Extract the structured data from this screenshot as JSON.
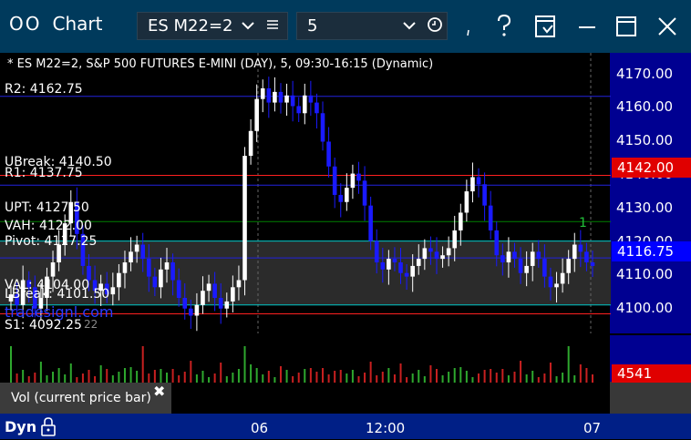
{
  "window": {
    "title": "Chart",
    "glyph": "OO",
    "symbol_select": "ES M22=2",
    "interval_select": "5"
  },
  "chart_header": "* ES M22=2, S&P 500 FUTURES E-MINI (DAY), 5, 09:30-16:15 (Dynamic)",
  "price_axis": {
    "ticks": [
      "4170.00",
      "4160.00",
      "4150.00",
      "4140.00",
      "4130.00",
      "4120.00",
      "4110.00",
      "4100.00"
    ],
    "badges": [
      {
        "label": "4142.00",
        "color": "#e00000"
      },
      {
        "label": "4116.75",
        "color": "#0000ff"
      }
    ]
  },
  "levels": {
    "r2": "R2: 4162.75",
    "ubreak": "UBreak: 4140.50",
    "r1": "R1: 4137.75",
    "upt": "UPT: 4127.50",
    "vah": "VAH: 4122.00",
    "pivot": "Pivot: 4117.25",
    "val": "VAL: 4104.00",
    "lbreak": "LBreak: 4101.50",
    "s1": "S1: 4092.25",
    "watermark": "tradesignl.com",
    "partial": "22",
    "marker": "1"
  },
  "volume": {
    "label": "Vol (current price bar)",
    "badge": "4541",
    "badge_color": "#e00000"
  },
  "time_axis": {
    "ticks": [
      "06",
      "12:00",
      "07"
    ]
  },
  "bottom_bar": {
    "label": "Dyn",
    "lock_icon": "lock-icon"
  },
  "chart_data": {
    "type": "candlestick",
    "ylim": [
      4096,
      4175
    ],
    "overlay_levels": [
      {
        "name": "R2",
        "value": 4162.75,
        "color": "#2222dd"
      },
      {
        "name": "UBreak",
        "value": 4140.5,
        "color": "#ff2020"
      },
      {
        "name": "R1",
        "value": 4137.75,
        "color": "#2222dd"
      },
      {
        "name": "UPT",
        "value": 4127.5,
        "color": "#008000"
      },
      {
        "name": "VAH",
        "value": 4122.0,
        "color": "#00c8c8"
      },
      {
        "name": "Pivot",
        "value": 4117.25,
        "color": "#2222dd"
      },
      {
        "name": "VAL",
        "value": 4104.0,
        "color": "#00c8c8"
      },
      {
        "name": "LBreak",
        "value": 4101.5,
        "color": "#ff2020"
      },
      {
        "name": "S1",
        "value": 4092.25,
        "color": "#2222dd"
      }
    ],
    "closes": [
      4107,
      4104,
      4111,
      4109,
      4103,
      4106,
      4112,
      4116,
      4121,
      4127,
      4133,
      4124,
      4115,
      4111,
      4108,
      4110,
      4107,
      4109,
      4113,
      4116,
      4119,
      4121,
      4117,
      4112,
      4109,
      4114,
      4116,
      4111,
      4106,
      4103,
      4101,
      4104,
      4108,
      4110,
      4106,
      4103,
      4105,
      4109,
      4111,
      4146,
      4153,
      4162,
      4165,
      4161,
      4164,
      4161,
      4163,
      4160,
      4158,
      4163,
      4161,
      4158,
      4150,
      4143,
      4135,
      4133,
      4137,
      4141,
      4139,
      4132,
      4122,
      4116,
      4114,
      4117,
      4116,
      4113,
      4112,
      4115,
      4117,
      4120,
      4119,
      4117,
      4118,
      4120,
      4125,
      4130,
      4136,
      4140,
      4138,
      4132,
      4125,
      4118,
      4116,
      4119,
      4117,
      4113,
      4115,
      4119,
      4117,
      4112,
      4109,
      4110,
      4113,
      4117,
      4121,
      4119,
      4116,
      4115
    ]
  }
}
